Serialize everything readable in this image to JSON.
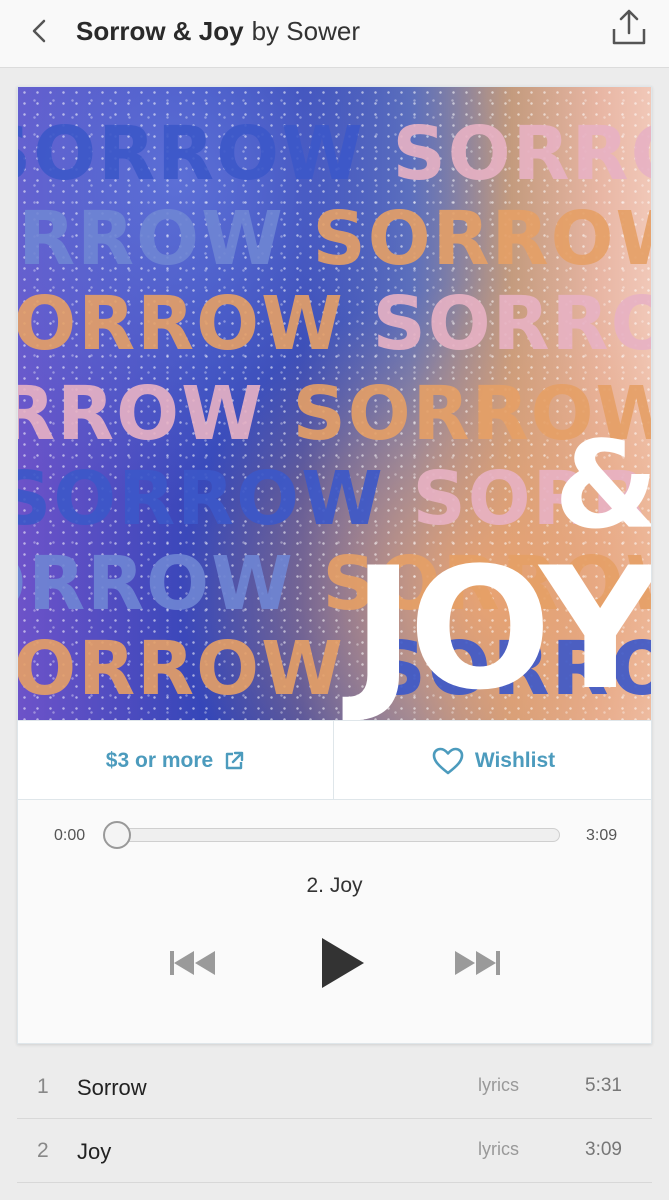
{
  "header": {
    "album_title": "Sorrow & Joy",
    "by_artist": "by Sower",
    "back_icon": "chevron-left-icon",
    "share_icon": "share-icon"
  },
  "cover": {
    "repeated_word": "SORROW",
    "amp": "&",
    "joy": "JOY"
  },
  "actions": {
    "buy_label": "$3 or more",
    "buy_icon": "external-link-icon",
    "wishlist_label": "Wishlist",
    "wishlist_icon": "heart-icon",
    "accent": "#4c9bbd"
  },
  "player": {
    "current_time": "0:00",
    "total_time": "3:09",
    "progress": 0,
    "now_playing": "2. Joy",
    "prev_icon": "skip-back-icon",
    "play_icon": "play-icon",
    "next_icon": "skip-forward-icon"
  },
  "tracks": [
    {
      "num": "1",
      "title": "Sorrow",
      "lyrics": "lyrics",
      "duration": "5:31"
    },
    {
      "num": "2",
      "title": "Joy",
      "lyrics": "lyrics",
      "duration": "3:09"
    }
  ]
}
